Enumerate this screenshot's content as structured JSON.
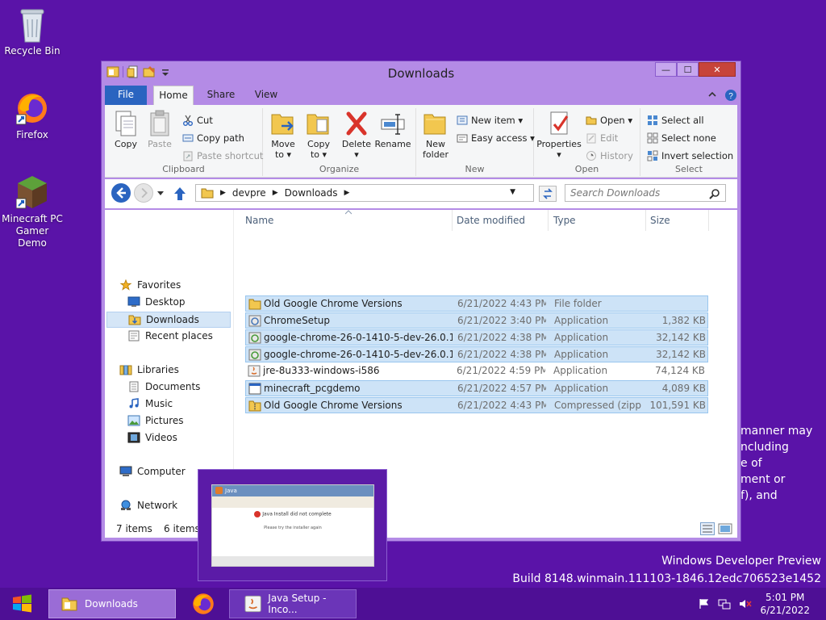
{
  "desktop": {
    "icons": [
      {
        "label": "Recycle Bin"
      },
      {
        "label": "Firefox"
      },
      {
        "label": "Minecraft PC Gamer Demo"
      }
    ],
    "behind_text": "manner may\nncluding\ne of\nment or\nf), and",
    "watermark": {
      "line1": "Windows Developer Preview",
      "line2": "Build 8148.winmain.111103-1846.12edc706523e1452"
    }
  },
  "window": {
    "title": "Downloads",
    "controls": {
      "minimize": "—",
      "maximize": "☐",
      "close": "✕"
    },
    "tabs": {
      "file": "File",
      "home": "Home",
      "share": "Share",
      "view": "View"
    },
    "ribbon": {
      "clipboard": {
        "label": "Clipboard",
        "copy": "Copy",
        "paste": "Paste",
        "cut": "Cut",
        "copy_path": "Copy path",
        "paste_shortcut": "Paste shortcut"
      },
      "organize": {
        "label": "Organize",
        "move_to": "Move",
        "move_to2": "to ▾",
        "copy_to": "Copy",
        "copy_to2": "to ▾",
        "delete": "Delete",
        "delete2": "▾",
        "rename": "Rename"
      },
      "new": {
        "label": "New",
        "new_folder": "New",
        "new_folder2": "folder",
        "new_item": "New item ▾",
        "easy_access": "Easy access ▾"
      },
      "open": {
        "label": "Open",
        "properties": "Properties",
        "properties2": "▾",
        "open": "Open ▾",
        "edit": "Edit",
        "history": "History"
      },
      "select": {
        "label": "Select",
        "select_all": "Select all",
        "select_none": "Select none",
        "invert": "Invert selection"
      }
    },
    "address": {
      "segments": [
        "devpre",
        "Downloads"
      ],
      "search_placeholder": "Search Downloads"
    },
    "nav": {
      "favorites": "Favorites",
      "desktop": "Desktop",
      "downloads": "Downloads",
      "recent": "Recent places",
      "libraries": "Libraries",
      "documents": "Documents",
      "music": "Music",
      "pictures": "Pictures",
      "videos": "Videos",
      "computer": "Computer",
      "network": "Network"
    },
    "columns": {
      "name": "Name",
      "date": "Date modified",
      "type": "Type",
      "size": "Size"
    },
    "files": [
      {
        "name": "Old Google Chrome Versions",
        "date": "6/21/2022 4:43 PM",
        "type": "File folder",
        "size": ""
      },
      {
        "name": "ChromeSetup",
        "date": "6/21/2022 3:40 PM",
        "type": "Application",
        "size": "1,382 KB"
      },
      {
        "name": "google-chrome-26-0-1410-5-dev-26.0.14...",
        "date": "6/21/2022 4:38 PM",
        "type": "Application",
        "size": "32,142 KB"
      },
      {
        "name": "google-chrome-26-0-1410-5-dev-26.0.14...",
        "date": "6/21/2022 4:38 PM",
        "type": "Application",
        "size": "32,142 KB"
      },
      {
        "name": "jre-8u333-windows-i586",
        "date": "6/21/2022 4:59 PM",
        "type": "Application",
        "size": "74,124 KB"
      },
      {
        "name": "minecraft_pcgdemo",
        "date": "6/21/2022 4:57 PM",
        "type": "Application",
        "size": "4,089 KB"
      },
      {
        "name": "Old Google Chrome Versions",
        "date": "6/21/2022 4:43 PM",
        "type": "Compressed (zipp...",
        "size": "101,591 KB"
      }
    ],
    "status": {
      "items": "7 items",
      "selected": "6 items"
    }
  },
  "thumbnail": {
    "title": "Java",
    "heading": "Java Install did not complete",
    "body": "Please try the installer again"
  },
  "taskbar": {
    "items": [
      {
        "label": "Downloads"
      },
      {
        "label": "Java Setup - Inco..."
      }
    ],
    "time": "5:01 PM",
    "date": "6/21/2022"
  },
  "colors": {
    "desktop": "#5a13a8",
    "window_frame": "#b48be6",
    "selection": "#cde3f7",
    "accent": "#2a64c0"
  }
}
